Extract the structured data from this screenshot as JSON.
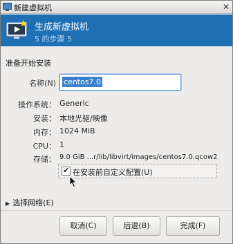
{
  "window": {
    "title": "新建虚拟机",
    "close_glyph": "✕"
  },
  "header": {
    "title": "生成新虚拟机",
    "step": "5 的步骤 5",
    "bg_color": "#1f6fb5"
  },
  "section_title": "准备开始安装",
  "name": {
    "label": "名称(N)",
    "value": "centos7.0"
  },
  "details": [
    {
      "label": "操作系统：",
      "value": "Generic"
    },
    {
      "label": "安装：",
      "value": "本地光驱/映像"
    },
    {
      "label": "内存：",
      "value": "1024 MiB"
    },
    {
      "label": "CPU：",
      "value": "1"
    },
    {
      "label": "存储：",
      "value": "9.0 GiB ...r/lib/libvirt/images/centos7.0.qcow2"
    }
  ],
  "customize_checkbox": {
    "label": "在安装前自定义配置(U)",
    "checked": true,
    "check_glyph": "✔"
  },
  "network_expander": {
    "label": "选择网络(E)",
    "arrow_glyph": "▶"
  },
  "buttons": {
    "cancel": "取消(C)",
    "back": "后退(B)",
    "finish": "完成(F)"
  }
}
